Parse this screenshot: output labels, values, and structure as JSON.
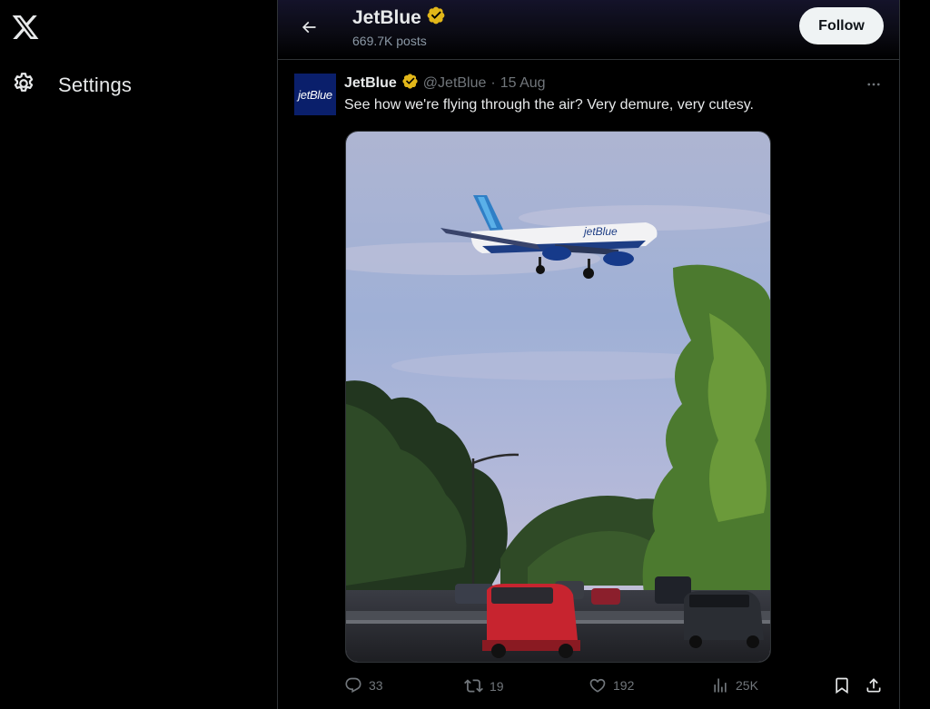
{
  "nav": {
    "logo_icon": "x-logo-icon",
    "settings_label": "Settings",
    "settings_icon": "gear-icon"
  },
  "header": {
    "title": "JetBlue",
    "posts_count": "669.7K posts",
    "follow_label": "Follow",
    "back_icon": "arrow-left-icon",
    "verified_icon": "verified-badge-icon"
  },
  "tweet": {
    "avatar_text": "jetBlue",
    "author": "JetBlue",
    "handle": "@JetBlue",
    "separator": "·",
    "date": "15 Aug",
    "text": "See how we're flying through the air? Very demure, very cutesy.",
    "media_alt": "JetBlue plane landing over a highway lined with trees",
    "more_icon": "more-horizontal-icon",
    "metrics": {
      "replies": "33",
      "reposts": "19",
      "likes": "192",
      "views": "25K"
    }
  },
  "colors": {
    "background": "#000000",
    "text_primary": "#e7e9ea",
    "text_secondary": "#71767b",
    "border": "#2f3336",
    "verified_gold": "#e2b719",
    "follow_bg": "#eff3f4",
    "jetblue_navy": "#0a1f6b"
  }
}
